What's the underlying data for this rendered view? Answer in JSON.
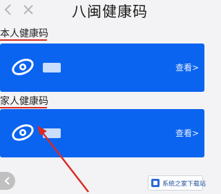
{
  "header": {
    "title": "八闽健康码",
    "back_icon": "back-chevron-icon",
    "close_icon": "close-icon"
  },
  "sections": {
    "self": {
      "label": "本人健康码",
      "view_label": "查看>"
    },
    "family": {
      "label": "家人健康码",
      "view_label": "查看>"
    }
  },
  "colors": {
    "card_blue": "#0b64f0",
    "annotation_red": "#d92a22",
    "page_bg": "#f3f3f5"
  },
  "overlay": {
    "watermark_text": "系统之家下载站"
  }
}
